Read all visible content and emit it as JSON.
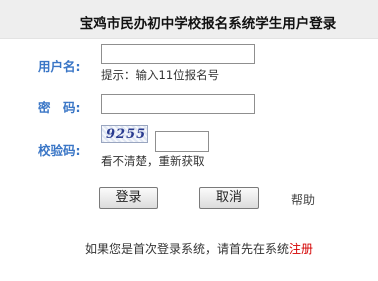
{
  "header": {
    "title": "宝鸡市民办初中学校报名系统学生用户登录"
  },
  "form": {
    "username_label": "用户名:",
    "username_value": "",
    "username_hint": "提示：输入11位报名号",
    "password_label": "密　码:",
    "password_value": "",
    "captcha_label": "校验码:",
    "captcha_code": "9255",
    "captcha_value": "",
    "captcha_refresh": "看不清楚，重新获取"
  },
  "buttons": {
    "login": "登录",
    "cancel": "取消",
    "help": "帮助"
  },
  "footer": {
    "text": "如果您是首次登录系统，请首先在系统",
    "register_link": "注册"
  },
  "colors": {
    "label": "#3a76c6",
    "register": "#d40000",
    "header_bg": "#eeeeee"
  }
}
